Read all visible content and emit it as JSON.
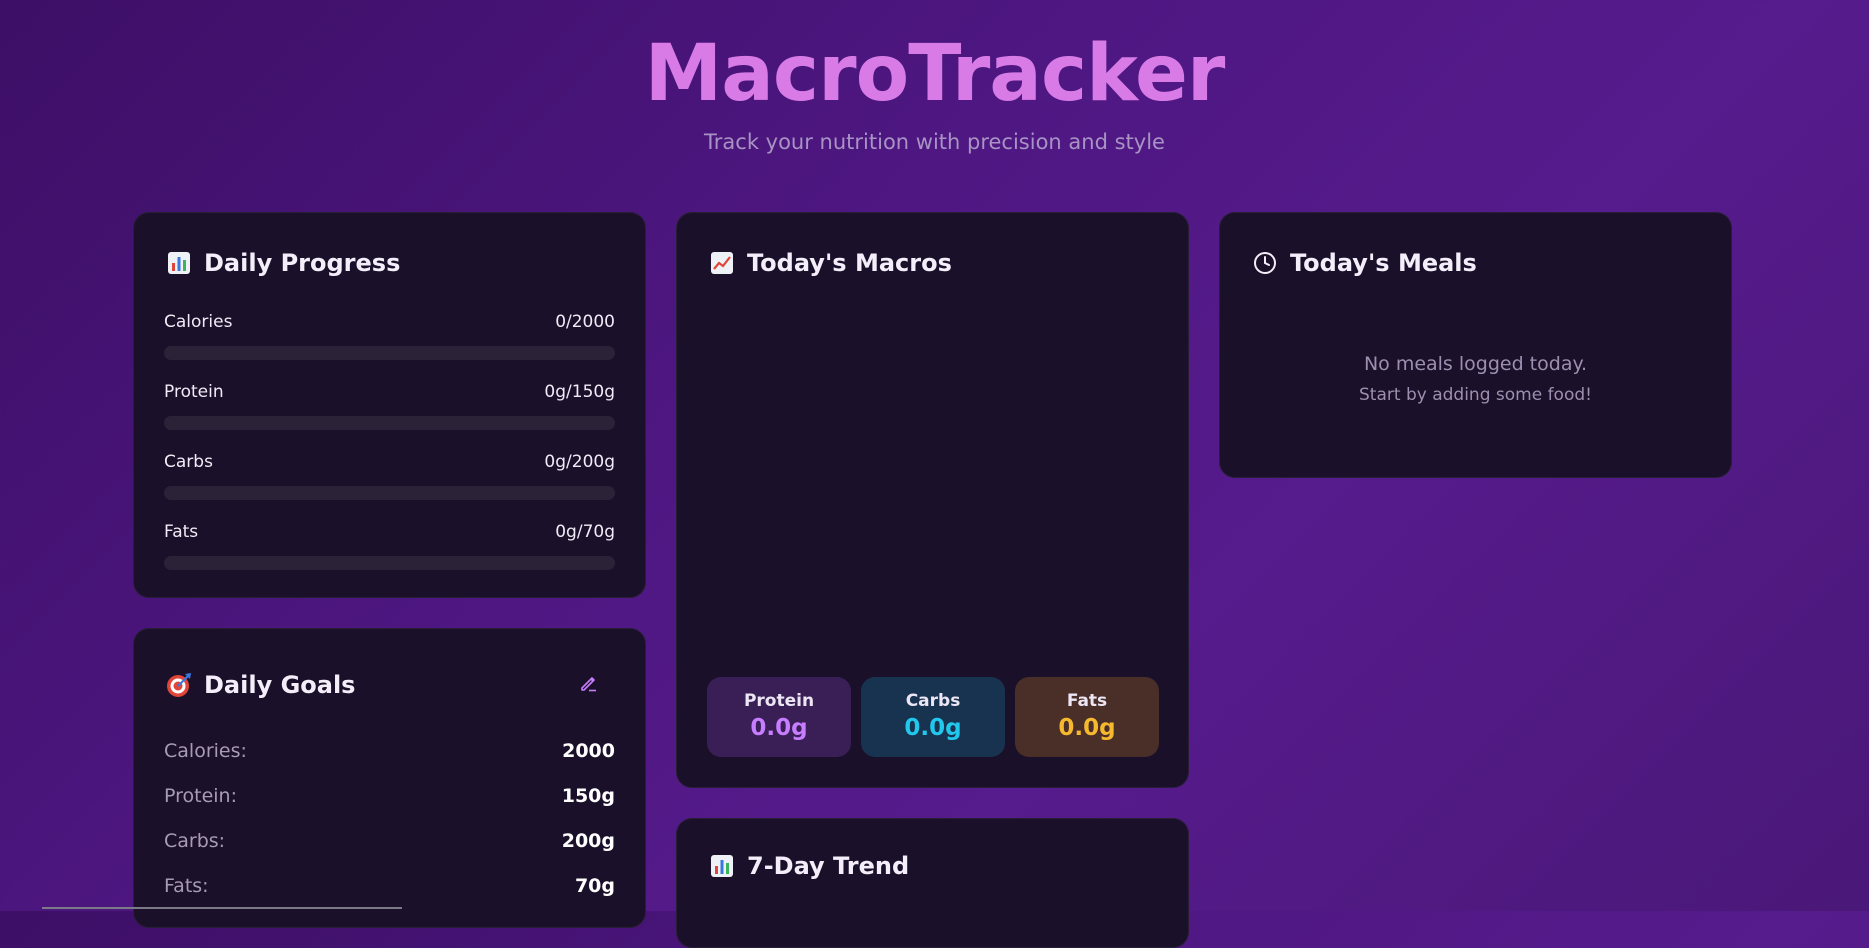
{
  "header": {
    "title": "MacroTracker",
    "subtitle": "Track your nutrition with precision and style"
  },
  "daily_progress": {
    "title": "Daily Progress",
    "icon": "bar-chart-icon",
    "items": [
      {
        "label": "Calories",
        "value": "0/2000",
        "fraction": 0
      },
      {
        "label": "Protein",
        "value": "0g/150g",
        "fraction": 0
      },
      {
        "label": "Carbs",
        "value": "0g/200g",
        "fraction": 0
      },
      {
        "label": "Fats",
        "value": "0g/70g",
        "fraction": 0
      }
    ]
  },
  "daily_goals": {
    "title": "Daily Goals",
    "icon": "target-icon",
    "edit_icon": "pencil-icon",
    "items": [
      {
        "label": "Calories:",
        "value": "2000"
      },
      {
        "label": "Protein:",
        "value": "150g"
      },
      {
        "label": "Carbs:",
        "value": "200g"
      },
      {
        "label": "Fats:",
        "value": "70g"
      }
    ]
  },
  "todays_macros": {
    "title": "Today's Macros",
    "icon": "trending-chart-icon",
    "boxes": [
      {
        "label": "Protein",
        "value": "0.0g",
        "color": "#c77dff",
        "bg": "#3a1f57"
      },
      {
        "label": "Carbs",
        "value": "0.0g",
        "color": "#22c7ee",
        "bg": "#18334f"
      },
      {
        "label": "Fats",
        "value": "0.0g",
        "color": "#f5b82e",
        "bg": "#4a2e28"
      }
    ]
  },
  "todays_meals": {
    "title": "Today's Meals",
    "icon": "clock-icon",
    "empty_title": "No meals logged today.",
    "empty_subtitle": "Start by adding some food!"
  },
  "trend": {
    "title": "7-Day Trend",
    "icon": "bar-chart-icon"
  },
  "colors": {
    "accent": "#d97be6",
    "card_bg": "#1b1029",
    "track": "#2c2238"
  }
}
